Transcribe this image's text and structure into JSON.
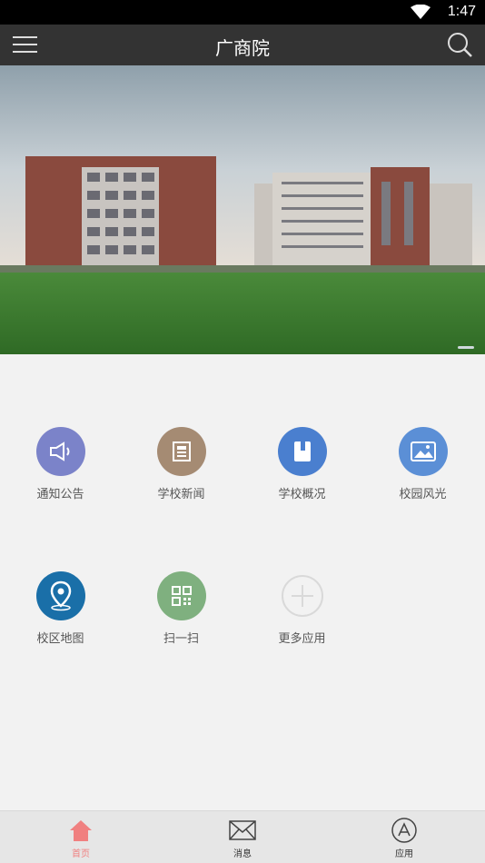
{
  "status_bar": {
    "time": "1:47"
  },
  "header": {
    "title": "广商院"
  },
  "apps": [
    {
      "label": "通知公告",
      "icon": "megaphone-icon",
      "color": "#7b83c9"
    },
    {
      "label": "学校新闻",
      "icon": "newspaper-icon",
      "color": "#a58b73"
    },
    {
      "label": "学校概况",
      "icon": "book-icon",
      "color": "#4a7fcf"
    },
    {
      "label": "校园风光",
      "icon": "image-icon",
      "color": "#5b8fd6"
    },
    {
      "label": "校区地图",
      "icon": "map-pin-icon",
      "color": "#1a6fa8"
    },
    {
      "label": "扫一扫",
      "icon": "qr-code-icon",
      "color": "#7fb07f"
    },
    {
      "label": "更多应用",
      "icon": "plus-circle-icon",
      "color": "#d9d9d9"
    }
  ],
  "tabs": [
    {
      "label": "首页",
      "icon": "home-icon",
      "active": true
    },
    {
      "label": "消息",
      "icon": "envelope-icon",
      "active": false
    },
    {
      "label": "应用",
      "icon": "app-store-icon",
      "active": false
    }
  ],
  "colors": {
    "header_bg": "#333333",
    "tab_active": "#f08080"
  }
}
